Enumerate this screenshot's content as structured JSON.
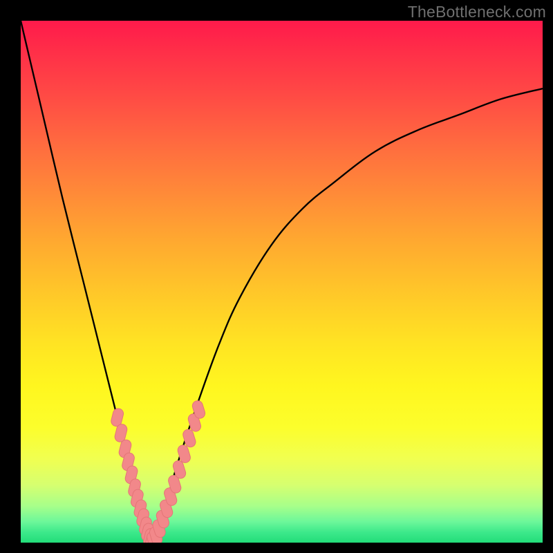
{
  "watermark": "TheBottleneck.com",
  "colors": {
    "background": "#000000",
    "gradient_top": "#ff1a4b",
    "gradient_bottom": "#22dd79",
    "curve_stroke": "#000000",
    "marker_fill": "#f2888a",
    "marker_stroke": "#e47577"
  },
  "chart_data": {
    "type": "line",
    "title": "",
    "xlabel": "",
    "ylabel": "",
    "xlim": [
      0,
      100
    ],
    "ylim": [
      0,
      100
    ],
    "grid": false,
    "annotations": [
      "TheBottleneck.com"
    ],
    "series": [
      {
        "name": "bottleneck-curve",
        "x": [
          0,
          4,
          8,
          12,
          16,
          18,
          20,
          22,
          24,
          25,
          26,
          28,
          30,
          34,
          38,
          42,
          48,
          54,
          60,
          68,
          76,
          84,
          92,
          100
        ],
        "y": [
          100,
          83,
          66,
          50,
          34,
          26,
          18,
          10,
          3,
          0,
          2,
          8,
          15,
          27,
          38,
          47,
          57,
          64,
          69,
          75,
          79,
          82,
          85,
          87
        ]
      }
    ],
    "markers": [
      {
        "name": "left-branch-markers",
        "points": [
          {
            "x": 18.5,
            "y": 24
          },
          {
            "x": 19.2,
            "y": 21
          },
          {
            "x": 20.0,
            "y": 18
          },
          {
            "x": 20.6,
            "y": 15.5
          },
          {
            "x": 21.2,
            "y": 13
          },
          {
            "x": 21.8,
            "y": 10.5
          },
          {
            "x": 22.3,
            "y": 8.5
          },
          {
            "x": 22.9,
            "y": 6.5
          },
          {
            "x": 23.4,
            "y": 4.8
          },
          {
            "x": 23.9,
            "y": 3.2
          },
          {
            "x": 24.3,
            "y": 2.0
          },
          {
            "x": 24.7,
            "y": 1.0
          },
          {
            "x": 25.0,
            "y": 0.3
          }
        ]
      },
      {
        "name": "right-branch-markers",
        "points": [
          {
            "x": 25.4,
            "y": 0.4
          },
          {
            "x": 25.9,
            "y": 1.3
          },
          {
            "x": 26.5,
            "y": 2.7
          },
          {
            "x": 27.2,
            "y": 4.5
          },
          {
            "x": 27.9,
            "y": 6.5
          },
          {
            "x": 28.7,
            "y": 8.8
          },
          {
            "x": 29.5,
            "y": 11.2
          },
          {
            "x": 30.4,
            "y": 14.0
          },
          {
            "x": 31.3,
            "y": 17.0
          },
          {
            "x": 32.3,
            "y": 20.0
          },
          {
            "x": 33.3,
            "y": 23.0
          },
          {
            "x": 34.1,
            "y": 25.5
          }
        ]
      }
    ]
  }
}
